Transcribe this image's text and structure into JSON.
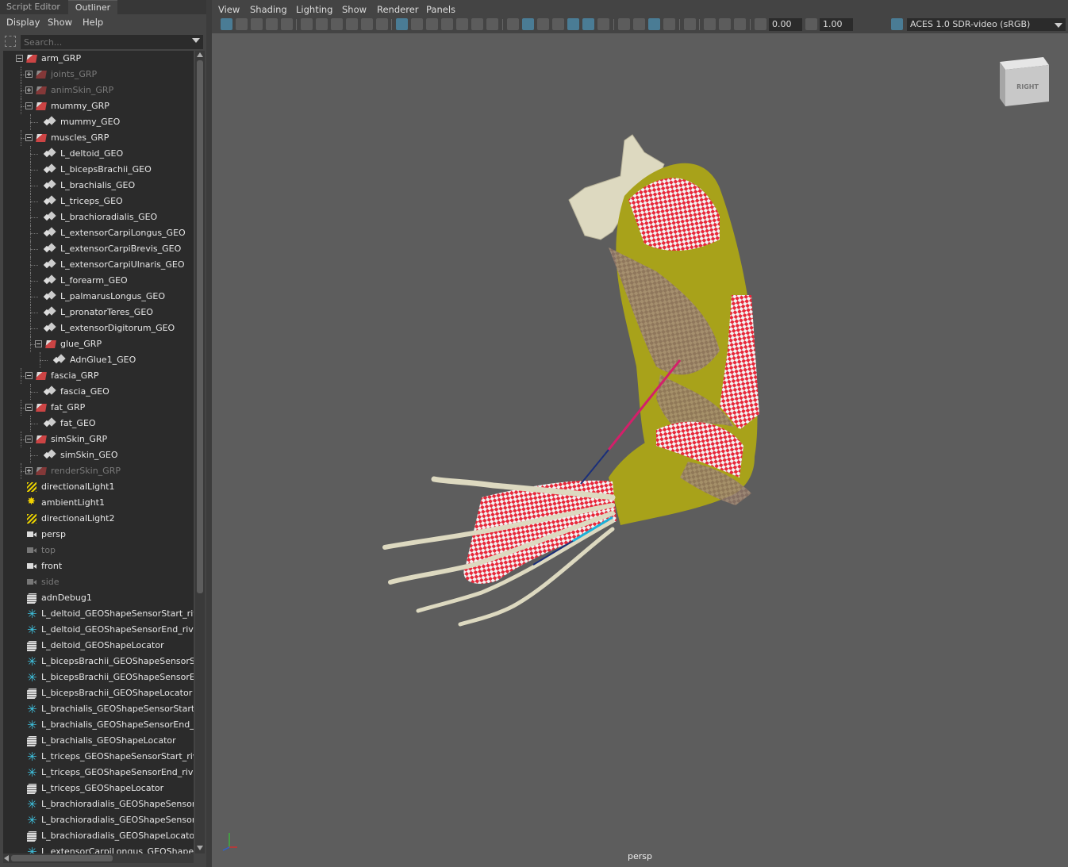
{
  "left_panel": {
    "tabs": [
      "Script Editor",
      "Outliner"
    ],
    "menu": [
      "Display",
      "Show",
      "Help"
    ],
    "search_placeholder": "Search..."
  },
  "outliner": [
    {
      "label": "arm_GRP",
      "icon": "group-icon",
      "level": 0,
      "expander": "minus",
      "dim": false
    },
    {
      "label": "joints_GRP",
      "icon": "group-icon",
      "level": 1,
      "expander": "plus",
      "dim": true
    },
    {
      "label": "animSkin_GRP",
      "icon": "group-icon",
      "level": 1,
      "expander": "plus",
      "dim": true
    },
    {
      "label": "mummy_GRP",
      "icon": "group-icon",
      "level": 1,
      "expander": "minus",
      "dim": false
    },
    {
      "label": "mummy_GEO",
      "icon": "mesh-icon",
      "level": 2,
      "expander": "",
      "dim": false
    },
    {
      "label": "muscles_GRP",
      "icon": "group-icon",
      "level": 1,
      "expander": "minus",
      "dim": false
    },
    {
      "label": "L_deltoid_GEO",
      "icon": "mesh-icon",
      "level": 2,
      "expander": "",
      "dim": false
    },
    {
      "label": "L_bicepsBrachii_GEO",
      "icon": "mesh-icon",
      "level": 2,
      "expander": "",
      "dim": false
    },
    {
      "label": "L_brachialis_GEO",
      "icon": "mesh-icon",
      "level": 2,
      "expander": "",
      "dim": false
    },
    {
      "label": "L_triceps_GEO",
      "icon": "mesh-icon",
      "level": 2,
      "expander": "",
      "dim": false
    },
    {
      "label": "L_brachioradialis_GEO",
      "icon": "mesh-icon",
      "level": 2,
      "expander": "",
      "dim": false
    },
    {
      "label": "L_extensorCarpiLongus_GEO",
      "icon": "mesh-icon",
      "level": 2,
      "expander": "",
      "dim": false
    },
    {
      "label": "L_extensorCarpiBrevis_GEO",
      "icon": "mesh-icon",
      "level": 2,
      "expander": "",
      "dim": false
    },
    {
      "label": "L_extensorCarpiUlnaris_GEO",
      "icon": "mesh-icon",
      "level": 2,
      "expander": "",
      "dim": false
    },
    {
      "label": "L_forearm_GEO",
      "icon": "mesh-icon",
      "level": 2,
      "expander": "",
      "dim": false
    },
    {
      "label": "L_palmarusLongus_GEO",
      "icon": "mesh-icon",
      "level": 2,
      "expander": "",
      "dim": false
    },
    {
      "label": "L_pronatorTeres_GEO",
      "icon": "mesh-icon",
      "level": 2,
      "expander": "",
      "dim": false
    },
    {
      "label": "L_extensorDigitorum_GEO",
      "icon": "mesh-icon",
      "level": 2,
      "expander": "",
      "dim": false
    },
    {
      "label": "glue_GRP",
      "icon": "group-icon",
      "level": 2,
      "expander": "minus",
      "dim": false
    },
    {
      "label": "AdnGlue1_GEO",
      "icon": "mesh-icon",
      "level": 3,
      "expander": "",
      "dim": false
    },
    {
      "label": "fascia_GRP",
      "icon": "group-icon",
      "level": 1,
      "expander": "minus",
      "dim": false
    },
    {
      "label": "fascia_GEO",
      "icon": "mesh-icon",
      "level": 2,
      "expander": "",
      "dim": false
    },
    {
      "label": "fat_GRP",
      "icon": "group-icon",
      "level": 1,
      "expander": "minus",
      "dim": false
    },
    {
      "label": "fat_GEO",
      "icon": "mesh-icon",
      "level": 2,
      "expander": "",
      "dim": false
    },
    {
      "label": "simSkin_GRP",
      "icon": "group-icon",
      "level": 1,
      "expander": "minus",
      "dim": false
    },
    {
      "label": "simSkin_GEO",
      "icon": "mesh-icon",
      "level": 2,
      "expander": "",
      "dim": false
    },
    {
      "label": "renderSkin_GRP",
      "icon": "group-icon",
      "level": 1,
      "expander": "plus",
      "dim": true
    },
    {
      "label": "directionalLight1",
      "icon": "directional-light-icon",
      "level": 0,
      "expander": "",
      "dim": false
    },
    {
      "label": "ambientLight1",
      "icon": "ambient-light-icon",
      "level": 0,
      "expander": "",
      "dim": false
    },
    {
      "label": "directionalLight2",
      "icon": "directional-light-icon",
      "level": 0,
      "expander": "",
      "dim": false
    },
    {
      "label": "persp",
      "icon": "camera-icon",
      "level": 0,
      "expander": "",
      "dim": false
    },
    {
      "label": "top",
      "icon": "camera-icon",
      "level": 0,
      "expander": "",
      "dim": true
    },
    {
      "label": "front",
      "icon": "camera-icon",
      "level": 0,
      "expander": "",
      "dim": false
    },
    {
      "label": "side",
      "icon": "camera-icon",
      "level": 0,
      "expander": "",
      "dim": true
    },
    {
      "label": "adnDebug1",
      "icon": "debug-icon",
      "level": 0,
      "expander": "",
      "dim": false
    },
    {
      "label": "L_deltoid_GEOShapeSensorStart_rive",
      "icon": "sensor-icon",
      "level": 0,
      "expander": "",
      "dim": false
    },
    {
      "label": "L_deltoid_GEOShapeSensorEnd_rivet_",
      "icon": "sensor-icon",
      "level": 0,
      "expander": "",
      "dim": false
    },
    {
      "label": "L_deltoid_GEOShapeLocator",
      "icon": "debug-icon",
      "level": 0,
      "expander": "",
      "dim": false
    },
    {
      "label": "L_bicepsBrachii_GEOShapeSensorSta",
      "icon": "sensor-icon",
      "level": 0,
      "expander": "",
      "dim": false
    },
    {
      "label": "L_bicepsBrachii_GEOShapeSensorEnc",
      "icon": "sensor-icon",
      "level": 0,
      "expander": "",
      "dim": false
    },
    {
      "label": "L_bicepsBrachii_GEOShapeLocator",
      "icon": "debug-icon",
      "level": 0,
      "expander": "",
      "dim": false
    },
    {
      "label": "L_brachialis_GEOShapeSensorStart_ri",
      "icon": "sensor-icon",
      "level": 0,
      "expander": "",
      "dim": false
    },
    {
      "label": "L_brachialis_GEOShapeSensorEnd_riv",
      "icon": "sensor-icon",
      "level": 0,
      "expander": "",
      "dim": false
    },
    {
      "label": "L_brachialis_GEOShapeLocator",
      "icon": "debug-icon",
      "level": 0,
      "expander": "",
      "dim": false
    },
    {
      "label": "L_triceps_GEOShapeSensorStart_rivet",
      "icon": "sensor-icon",
      "level": 0,
      "expander": "",
      "dim": false
    },
    {
      "label": "L_triceps_GEOShapeSensorEnd_rivet_",
      "icon": "sensor-icon",
      "level": 0,
      "expander": "",
      "dim": false
    },
    {
      "label": "L_triceps_GEOShapeLocator",
      "icon": "debug-icon",
      "level": 0,
      "expander": "",
      "dim": false
    },
    {
      "label": "L_brachioradialis_GEOShapeSensorSt",
      "icon": "sensor-icon",
      "level": 0,
      "expander": "",
      "dim": false
    },
    {
      "label": "L_brachioradialis_GEOShapeSensorEr",
      "icon": "sensor-icon",
      "level": 0,
      "expander": "",
      "dim": false
    },
    {
      "label": "L_brachioradialis_GEOShapeLocator",
      "icon": "debug-icon",
      "level": 0,
      "expander": "",
      "dim": false
    },
    {
      "label": "L_extensorCarpiLongus_GEOShapeSe",
      "icon": "sensor-icon",
      "level": 0,
      "expander": "",
      "dim": false
    }
  ],
  "viewport": {
    "menu": [
      "View",
      "Shading",
      "Lighting",
      "Show",
      "Renderer",
      "Panels"
    ],
    "exposure": "0.00",
    "gamma": "1.00",
    "color_space": "ACES 1.0 SDR-video (sRGB)",
    "view_cube_label": "RIGHT",
    "camera_label": "persp",
    "colors": {
      "skin": "#a8a21a",
      "checker_red": "#e8283a",
      "bone": "#ddd9c0",
      "background": "#5d5d5d"
    }
  }
}
